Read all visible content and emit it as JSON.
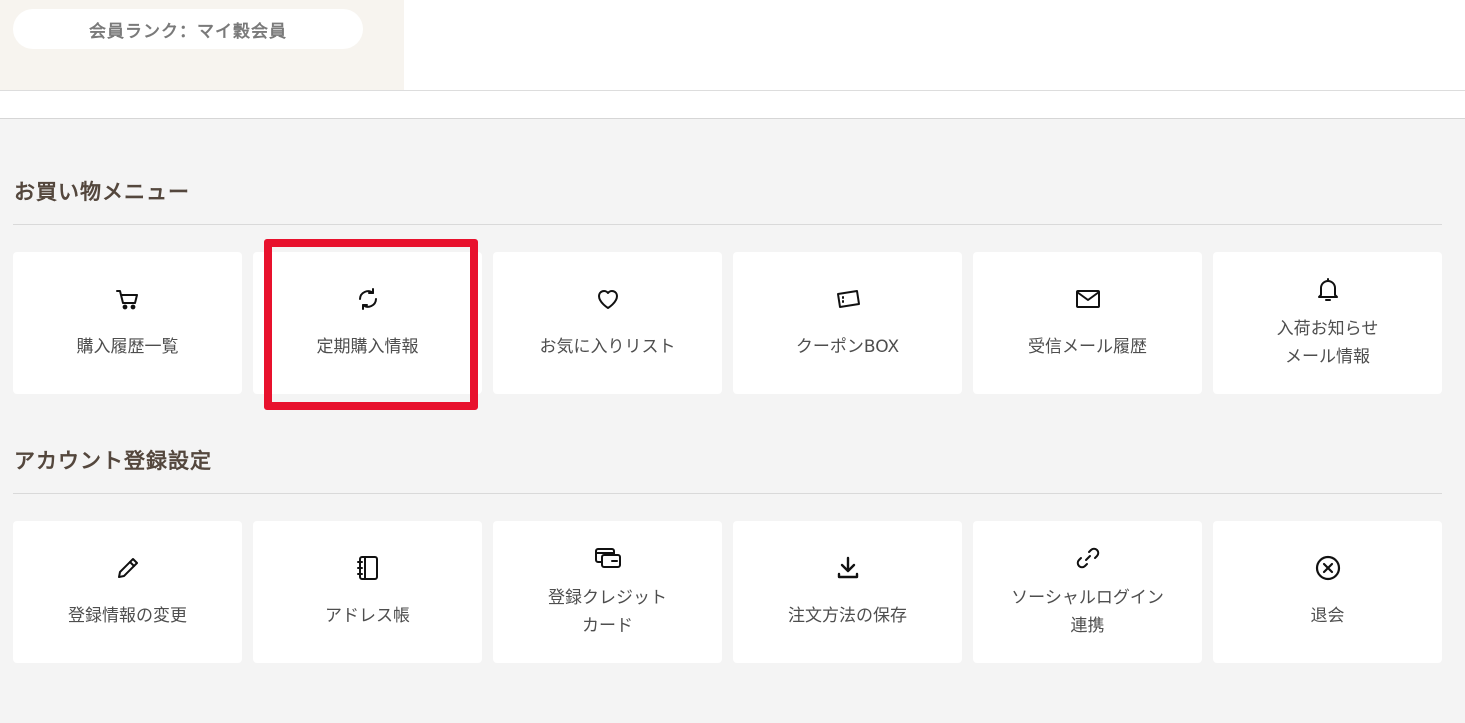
{
  "rank": {
    "label": "会員ランク：マイ穀会員"
  },
  "shopping": {
    "title": "お買い物メニュー",
    "items": [
      {
        "icon": "cart-icon",
        "label": "購入履歴一覧"
      },
      {
        "icon": "refresh-icon",
        "label": "定期購入情報"
      },
      {
        "icon": "heart-icon",
        "label": "お気に入りリスト"
      },
      {
        "icon": "ticket-icon",
        "label": "クーポンBOX"
      },
      {
        "icon": "envelope-icon",
        "label": "受信メール履歴"
      },
      {
        "icon": "bell-icon",
        "label": "入荷お知らせ\nメール情報"
      }
    ]
  },
  "account": {
    "title": "アカウント登録設定",
    "items": [
      {
        "icon": "pencil-icon",
        "label": "登録情報の変更"
      },
      {
        "icon": "address-book-icon",
        "label": "アドレス帳"
      },
      {
        "icon": "credit-card-icon",
        "label": "登録クレジット\nカード"
      },
      {
        "icon": "download-icon",
        "label": "注文方法の保存"
      },
      {
        "icon": "link-icon",
        "label": "ソーシャルログイン\n連携"
      },
      {
        "icon": "close-circle-icon",
        "label": "退会"
      }
    ]
  },
  "colors": {
    "highlight": "#e8112d",
    "text": "#54473d",
    "background": "#f4f4f4"
  }
}
